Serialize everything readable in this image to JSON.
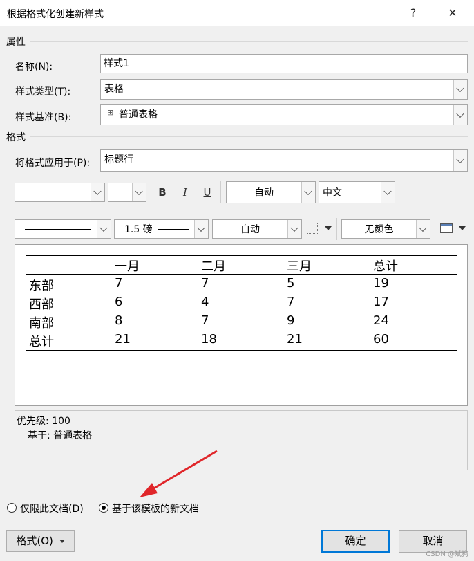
{
  "window": {
    "title": "根据格式化创建新样式",
    "help": "?",
    "close": "✕"
  },
  "properties": {
    "heading": "属性",
    "name_label": "名称(N):",
    "name_value": "样式1",
    "type_label": "样式类型(T):",
    "type_value": "表格",
    "base_label": "样式基准(B):",
    "base_value": "普通表格",
    "base_icon": "table-grid-icon"
  },
  "format": {
    "heading": "格式",
    "apply_label": "将格式应用于(P):",
    "apply_value": "标题行",
    "font_name": "",
    "font_size": "",
    "bold": "B",
    "italic": "I",
    "underline": "U",
    "color_value": "自动",
    "script_value": "中文",
    "border_style_value": "",
    "border_width_value": "1.5 磅",
    "border_color_value": "自动",
    "shading_value": "无颜色"
  },
  "preview": {
    "header": [
      "",
      "一月",
      "二月",
      "三月",
      "总计"
    ],
    "rows": [
      [
        "东部",
        "7",
        "7",
        "5",
        "19"
      ],
      [
        "西部",
        "6",
        "4",
        "7",
        "17"
      ],
      [
        "南部",
        "8",
        "7",
        "9",
        "24"
      ],
      [
        "总计",
        "21",
        "18",
        "21",
        "60"
      ]
    ]
  },
  "description": {
    "priority": "优先级: 100",
    "based_on": "基于: 普通表格"
  },
  "scope": {
    "option1": "仅限此文档(D)",
    "option2": "基于该模板的新文档",
    "selected": "option2"
  },
  "buttons": {
    "format": "格式(O)",
    "ok": "确定",
    "cancel": "取消"
  },
  "annotation": {
    "arrow_color": "#e0262a"
  },
  "watermark": "CSDN @斌狗"
}
